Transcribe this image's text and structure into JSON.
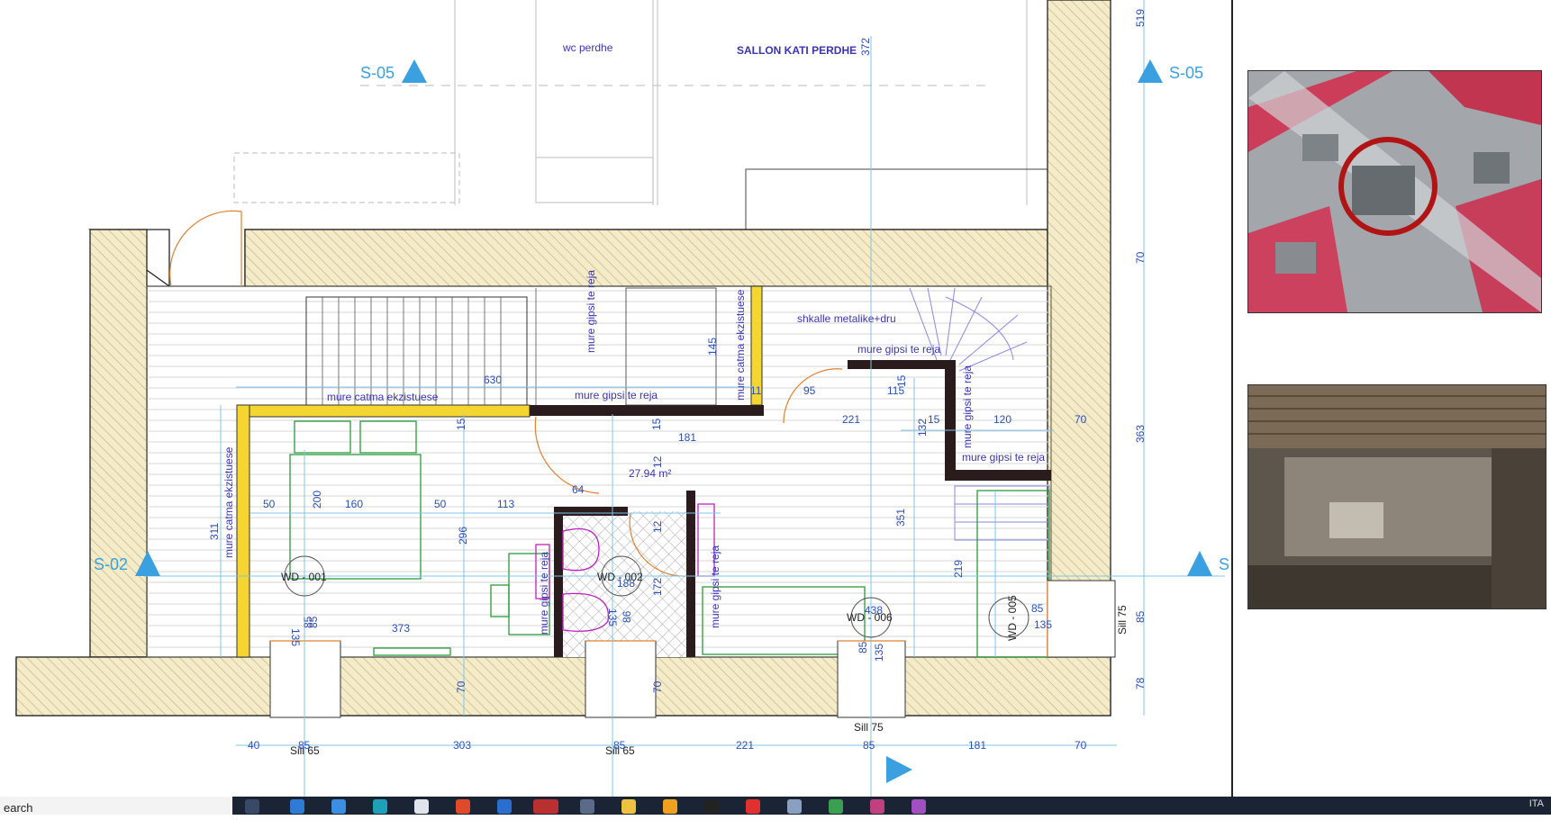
{
  "plan": {
    "section_marks": [
      "S-05",
      "S-05",
      "S-02",
      "S"
    ],
    "room_labels": {
      "wc": "wc perdhe",
      "sallon": "SALLON KATI PERDHE",
      "stairs": "shkalle metalike+dru",
      "area": "27.94 m²"
    },
    "wall_labels": {
      "catma_top": "mure catma ekzistuese",
      "catma_left": "mure catma ekzistuese",
      "catma_mid": "mure catma ekzistuese",
      "gipsi_top": "mure gipsi te reja",
      "gipsi_h1": "mure gipsi te reja",
      "gipsi_h2": "mure gipsi te reja",
      "gipsi_h3": "mure gipsi te reja",
      "gipsi_v1": "mure gipsi te reja",
      "gipsi_v2": "mure gipsi te reja",
      "gipsi_v3": "mure gipsi te reja"
    },
    "windows": {
      "wd001": "WD - 001",
      "wd002": "WD - 002",
      "wd005": "WD - 005",
      "wd006": "WD - 006"
    },
    "sills": {
      "s1": "Sill 65",
      "s2": "Sill 65",
      "s3": "Sill 75",
      "s4": "Sill 75"
    },
    "dimensions": {
      "d630": "630",
      "d145": "145",
      "d181": "181",
      "d95": "95",
      "d115": "115",
      "d221": "221",
      "d132": "132",
      "d15a": "15",
      "d15b": "15",
      "d15c": "15",
      "d15d": "15",
      "d120": "120",
      "d70a": "70",
      "d311": "311",
      "d200": "200",
      "d160": "160",
      "d50a": "50",
      "d50b": "50",
      "d113": "113",
      "d64": "64",
      "d12a": "12",
      "d12b": "12",
      "d296": "296",
      "d172": "172",
      "d351": "351",
      "d219": "219",
      "d188": "188",
      "d438": "438",
      "d85a": "85",
      "d135a": "135",
      "d135b": "135",
      "d135c": "135",
      "d135d": "135",
      "d85b": "85",
      "d85c": "85",
      "d86": "86",
      "d85d": "85",
      "d373": "373",
      "d70b": "70",
      "d70c": "70",
      "d11": "11",
      "d372": "372",
      "d519": "519",
      "d70r": "70",
      "d363": "363",
      "d85r": "85",
      "d78": "78",
      "bottom": [
        "40",
        "85",
        "303",
        "85",
        "221",
        "85",
        "181",
        "70"
      ]
    }
  },
  "taskbar": {
    "search_text": "earch",
    "tray_text": "ITA"
  }
}
